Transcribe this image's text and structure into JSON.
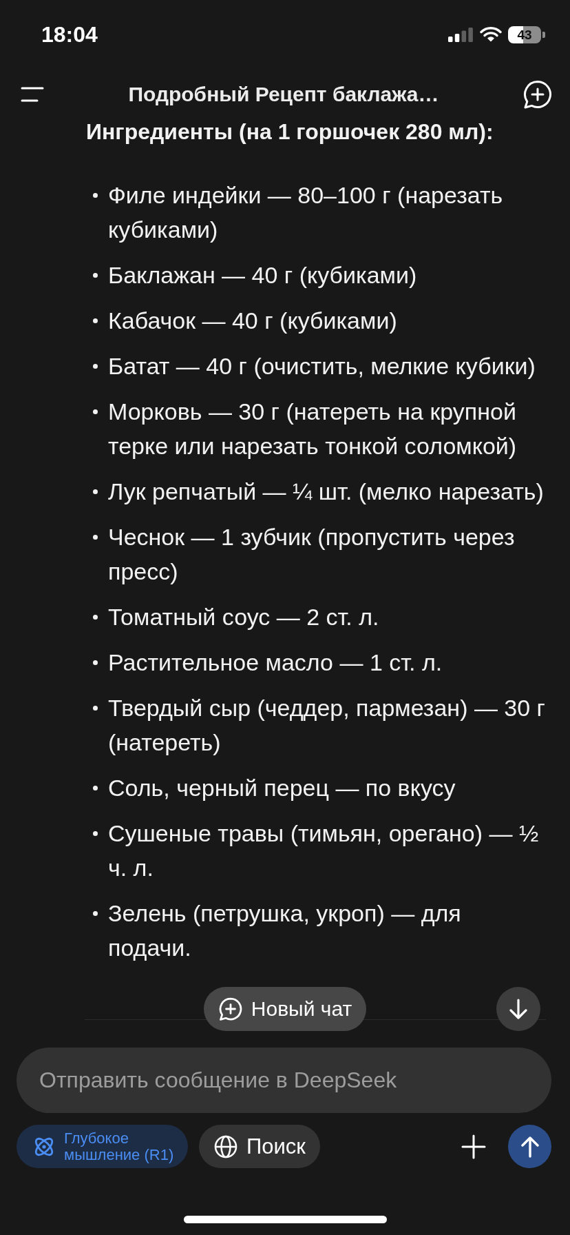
{
  "status_bar": {
    "time": "18:04",
    "battery": "43"
  },
  "header": {
    "title": "Подробный Рецепт баклажа…"
  },
  "message": {
    "heading": "Ингредиенты (на 1 горшочек 280 мл):",
    "ingredients": [
      "Филе индейки — 80–100 г (нарезать кубиками)",
      "Баклажан — 40 г (кубиками)",
      "Кабачок — 40 г (кубиками)",
      "Батат — 40 г (очистить, мелкие кубики)",
      "Морковь — 30 г (натереть на крупной терке или нарезать тонкой соломкой)",
      "Лук репчатый — ¼ шт. (мелко нарезать)",
      "Чеснок — 1 зубчик (пропустить через пресс)",
      "Томатный соус — 2 ст. л.",
      "Растительное масло — 1 ст. л.",
      "Твердый сыр (чеддер, пармезан) — 30 г (натереть)",
      "Соль, черный перец — по вкусу",
      "Сушеные травы (тимьян, орегано) — ½ ч. л.",
      "Зелень (петрушка, укроп) — для подачи."
    ]
  },
  "new_chat_button": {
    "label": "Новый чат"
  },
  "composer": {
    "placeholder": "Отправить сообщение в DeepSeek",
    "toggles": [
      {
        "kind": "reasoning",
        "label": "Глубокое мышление (R1)",
        "selected": true
      },
      {
        "kind": "search",
        "label": "Поиск",
        "selected": false
      }
    ]
  }
}
